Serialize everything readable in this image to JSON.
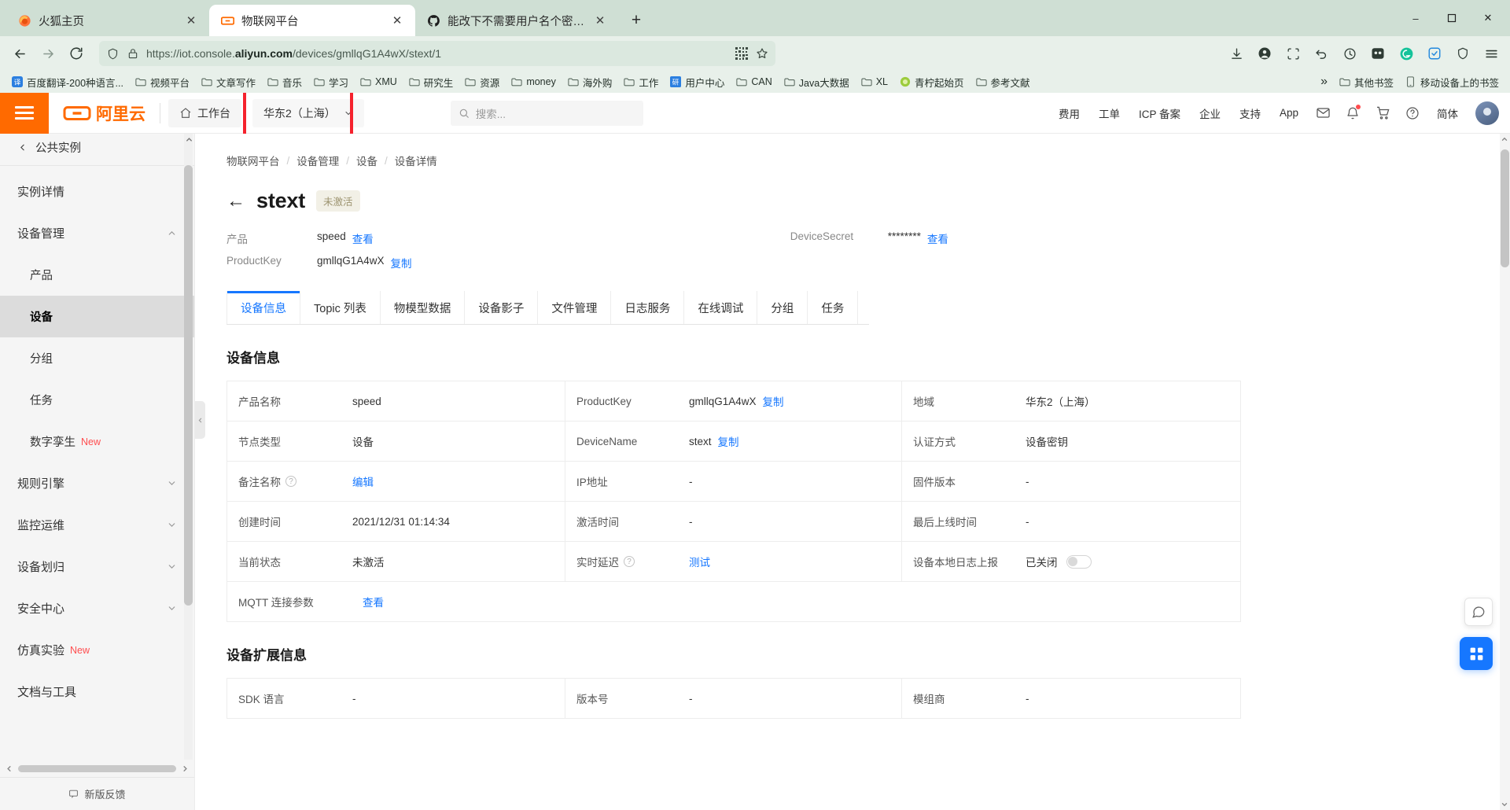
{
  "browser": {
    "tabs": [
      {
        "title": "火狐主页",
        "icon": "firefox-icon",
        "active": false
      },
      {
        "title": "物联网平台",
        "icon": "aliyun-icon",
        "active": true
      },
      {
        "title": "能改下不需要用户名个密码也可",
        "icon": "github-icon",
        "active": false
      }
    ],
    "new_tab_label": "+",
    "window_controls": {
      "minimize": "–",
      "maximize": "❐",
      "close": "✕"
    },
    "nav": {
      "back": "←",
      "forward": "→",
      "reload": "↻",
      "shield": "shield-icon",
      "lock": "lock-icon",
      "url_prefix": "https://iot.console.",
      "url_domain": "aliyun.com",
      "url_suffix": "/devices/gmllqG1A4wX/stext/1",
      "qr": "qr-icon",
      "bookmark_star": "star-icon",
      "download": "download-icon",
      "account": "account-icon",
      "container": "container-icon",
      "undo": "undo-icon",
      "history": "history-icon",
      "pocket": "pocket-icon",
      "grammarly": "grammarly-icon",
      "sync": "sync-icon",
      "shield2": "shield2-icon",
      "menu": "hamburger-menu-icon"
    },
    "bookmarks": [
      {
        "label": "百度翻译-200种语言...",
        "icon": "translate-icon"
      },
      {
        "label": "视频平台",
        "icon": "folder-icon"
      },
      {
        "label": "文章写作",
        "icon": "folder-icon"
      },
      {
        "label": "音乐",
        "icon": "folder-icon"
      },
      {
        "label": "学习",
        "icon": "folder-icon"
      },
      {
        "label": "XMU",
        "icon": "folder-icon"
      },
      {
        "label": "研究生",
        "icon": "folder-icon"
      },
      {
        "label": "资源",
        "icon": "folder-icon"
      },
      {
        "label": "money",
        "icon": "folder-icon"
      },
      {
        "label": "海外购",
        "icon": "folder-icon"
      },
      {
        "label": "工作",
        "icon": "folder-icon"
      },
      {
        "label": "用户中心",
        "icon": "yan-icon"
      },
      {
        "label": "CAN",
        "icon": "folder-icon"
      },
      {
        "label": "Java大数据",
        "icon": "folder-icon"
      },
      {
        "label": "XL",
        "icon": "folder-icon"
      },
      {
        "label": "青柠起始页",
        "icon": "lime-icon"
      },
      {
        "label": "参考文献",
        "icon": "folder-icon"
      }
    ],
    "bookmarks_overflow": "»",
    "bookmarks_right": [
      {
        "label": "其他书签",
        "icon": "folder-icon"
      },
      {
        "label": "移动设备上的书签",
        "icon": "mobile-icon"
      }
    ]
  },
  "header": {
    "logo_text": "阿里云",
    "workbench": "工作台",
    "region": "华东2（上海）",
    "region_chevron": "⌄",
    "search_placeholder": "搜索...",
    "links": [
      "费用",
      "工单",
      "ICP 备案",
      "企业",
      "支持",
      "App"
    ],
    "lang": "简体",
    "icons": [
      "mail-icon",
      "bell-icon",
      "cart-icon",
      "help-icon"
    ],
    "highlight_color": "#f5222d"
  },
  "sidebar": {
    "instance": "公共实例",
    "items": [
      {
        "label": "实例详情",
        "type": "item"
      },
      {
        "label": "设备管理",
        "type": "group",
        "expanded": true,
        "chevron": "∧"
      },
      {
        "label": "产品",
        "type": "sub"
      },
      {
        "label": "设备",
        "type": "sub",
        "active": true
      },
      {
        "label": "分组",
        "type": "sub"
      },
      {
        "label": "任务",
        "type": "sub"
      },
      {
        "label": "数字孪生",
        "type": "sub",
        "badge": "New"
      },
      {
        "label": "规则引擎",
        "type": "group",
        "chevron": "∨"
      },
      {
        "label": "监控运维",
        "type": "group",
        "chevron": "∨"
      },
      {
        "label": "设备划归",
        "type": "group",
        "chevron": "∨"
      },
      {
        "label": "安全中心",
        "type": "group",
        "chevron": "∨"
      },
      {
        "label": "仿真实验",
        "type": "item",
        "badge": "New"
      },
      {
        "label": "文档与工具",
        "type": "item"
      }
    ],
    "feedback": "新版反馈"
  },
  "main": {
    "breadcrumb": [
      "物联网平台",
      "设备管理",
      "设备",
      "设备详情"
    ],
    "breadcrumb_sep": "/",
    "back_arrow": "←",
    "device_title": "stext",
    "status_badge": "未激活",
    "summary": {
      "product_label": "产品",
      "product_value": "speed",
      "product_link": "查看",
      "secret_label": "DeviceSecret",
      "secret_value": "********",
      "secret_link": "查看",
      "productkey_label": "ProductKey",
      "productkey_value": "gmllqG1A4wX",
      "productkey_link": "复制"
    },
    "tabs": [
      {
        "label": "设备信息",
        "active": true
      },
      {
        "label": "Topic 列表",
        "active": false
      },
      {
        "label": "物模型数据",
        "active": false
      },
      {
        "label": "设备影子",
        "active": false
      },
      {
        "label": "文件管理",
        "active": false
      },
      {
        "label": "日志服务",
        "active": false
      },
      {
        "label": "在线调试",
        "active": false
      },
      {
        "label": "分组",
        "active": false
      },
      {
        "label": "任务",
        "active": false
      }
    ],
    "section_device_info": "设备信息",
    "device_info_rows": [
      {
        "k1": "产品名称",
        "v1": "speed",
        "k2": "ProductKey",
        "v2": "gmllqG1A4wX",
        "v2_link": "复制",
        "k3": "地域",
        "v3": "华东2（上海）"
      },
      {
        "k1": "节点类型",
        "v1": "设备",
        "k2": "DeviceName",
        "v2": "stext",
        "v2_link": "复制",
        "k3": "认证方式",
        "v3": "设备密钥"
      },
      {
        "k1": "备注名称",
        "k1_help": "?",
        "v1_link": "编辑",
        "k2": "IP地址",
        "v2": "-",
        "k3": "固件版本",
        "v3": "-"
      },
      {
        "k1": "创建时间",
        "v1": "2021/12/31 01:14:34",
        "k2": "激活时间",
        "v2": "-",
        "k3": "最后上线时间",
        "v3": "-"
      },
      {
        "k1": "当前状态",
        "v1": "未激活",
        "k2": "实时延迟",
        "k2_help": "?",
        "v2_link": "测试",
        "k3": "设备本地日志上报",
        "v3": "已关闭",
        "v3_toggle": true
      },
      {
        "k1": "MQTT 连接参数",
        "v1_link": "查看",
        "wide": true
      }
    ],
    "section_device_ext": "设备扩展信息",
    "device_ext_rows": [
      {
        "k1": "SDK 语言",
        "v1": "-",
        "k2": "版本号",
        "v2": "-",
        "k3": "模组商",
        "v3": "-"
      }
    ]
  }
}
